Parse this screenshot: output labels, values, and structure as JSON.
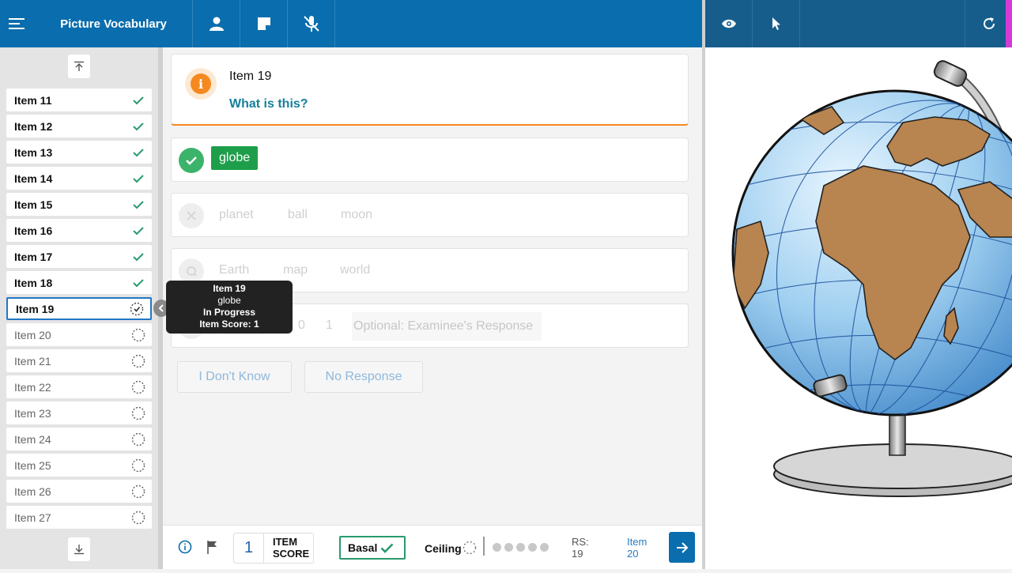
{
  "app": {
    "title": "Picture Vocabulary"
  },
  "sidebar": {
    "items": [
      {
        "label": "Item 11",
        "status": "done"
      },
      {
        "label": "Item 12",
        "status": "done"
      },
      {
        "label": "Item 13",
        "status": "done"
      },
      {
        "label": "Item 14",
        "status": "done"
      },
      {
        "label": "Item 15",
        "status": "done"
      },
      {
        "label": "Item 16",
        "status": "done"
      },
      {
        "label": "Item 17",
        "status": "done"
      },
      {
        "label": "Item 18",
        "status": "done"
      },
      {
        "label": "Item 19",
        "status": "current"
      },
      {
        "label": "Item 20",
        "status": "todo"
      },
      {
        "label": "Item 21",
        "status": "todo"
      },
      {
        "label": "Item 22",
        "status": "todo"
      },
      {
        "label": "Item 23",
        "status": "todo"
      },
      {
        "label": "Item 24",
        "status": "todo"
      },
      {
        "label": "Item 25",
        "status": "todo"
      },
      {
        "label": "Item 26",
        "status": "todo"
      },
      {
        "label": "Item 27",
        "status": "todo"
      }
    ]
  },
  "tooltip": {
    "title": "Item 19",
    "answer": "globe",
    "status": "In Progress",
    "score": "Item Score: 1"
  },
  "question": {
    "item": "Item 19",
    "prompt": "What is this?"
  },
  "answers": {
    "correct": {
      "chip": "globe"
    },
    "incorrect": {
      "options": [
        "planet",
        "ball",
        "moon"
      ]
    },
    "query": {
      "options": [
        "Earth",
        "map",
        "world"
      ]
    },
    "score": {
      "zero": "0",
      "one": "1",
      "placeholder": "Optional: Examinee's Response"
    }
  },
  "buttons": {
    "dont_know": "I Don't Know",
    "no_response": "No Response"
  },
  "footer": {
    "item_score_value": "1",
    "item_score_line1": "ITEM",
    "item_score_line2": "SCORE",
    "basal": "Basal",
    "ceiling": "Ceiling",
    "rs_label": "RS:",
    "rs_value": "19",
    "next_label": "Item",
    "next_value": "20",
    "ceiling_dots": 5
  },
  "colors": {
    "primary": "#0a6dad",
    "correct": "#1e9e4a",
    "accent": "#f5891f"
  }
}
